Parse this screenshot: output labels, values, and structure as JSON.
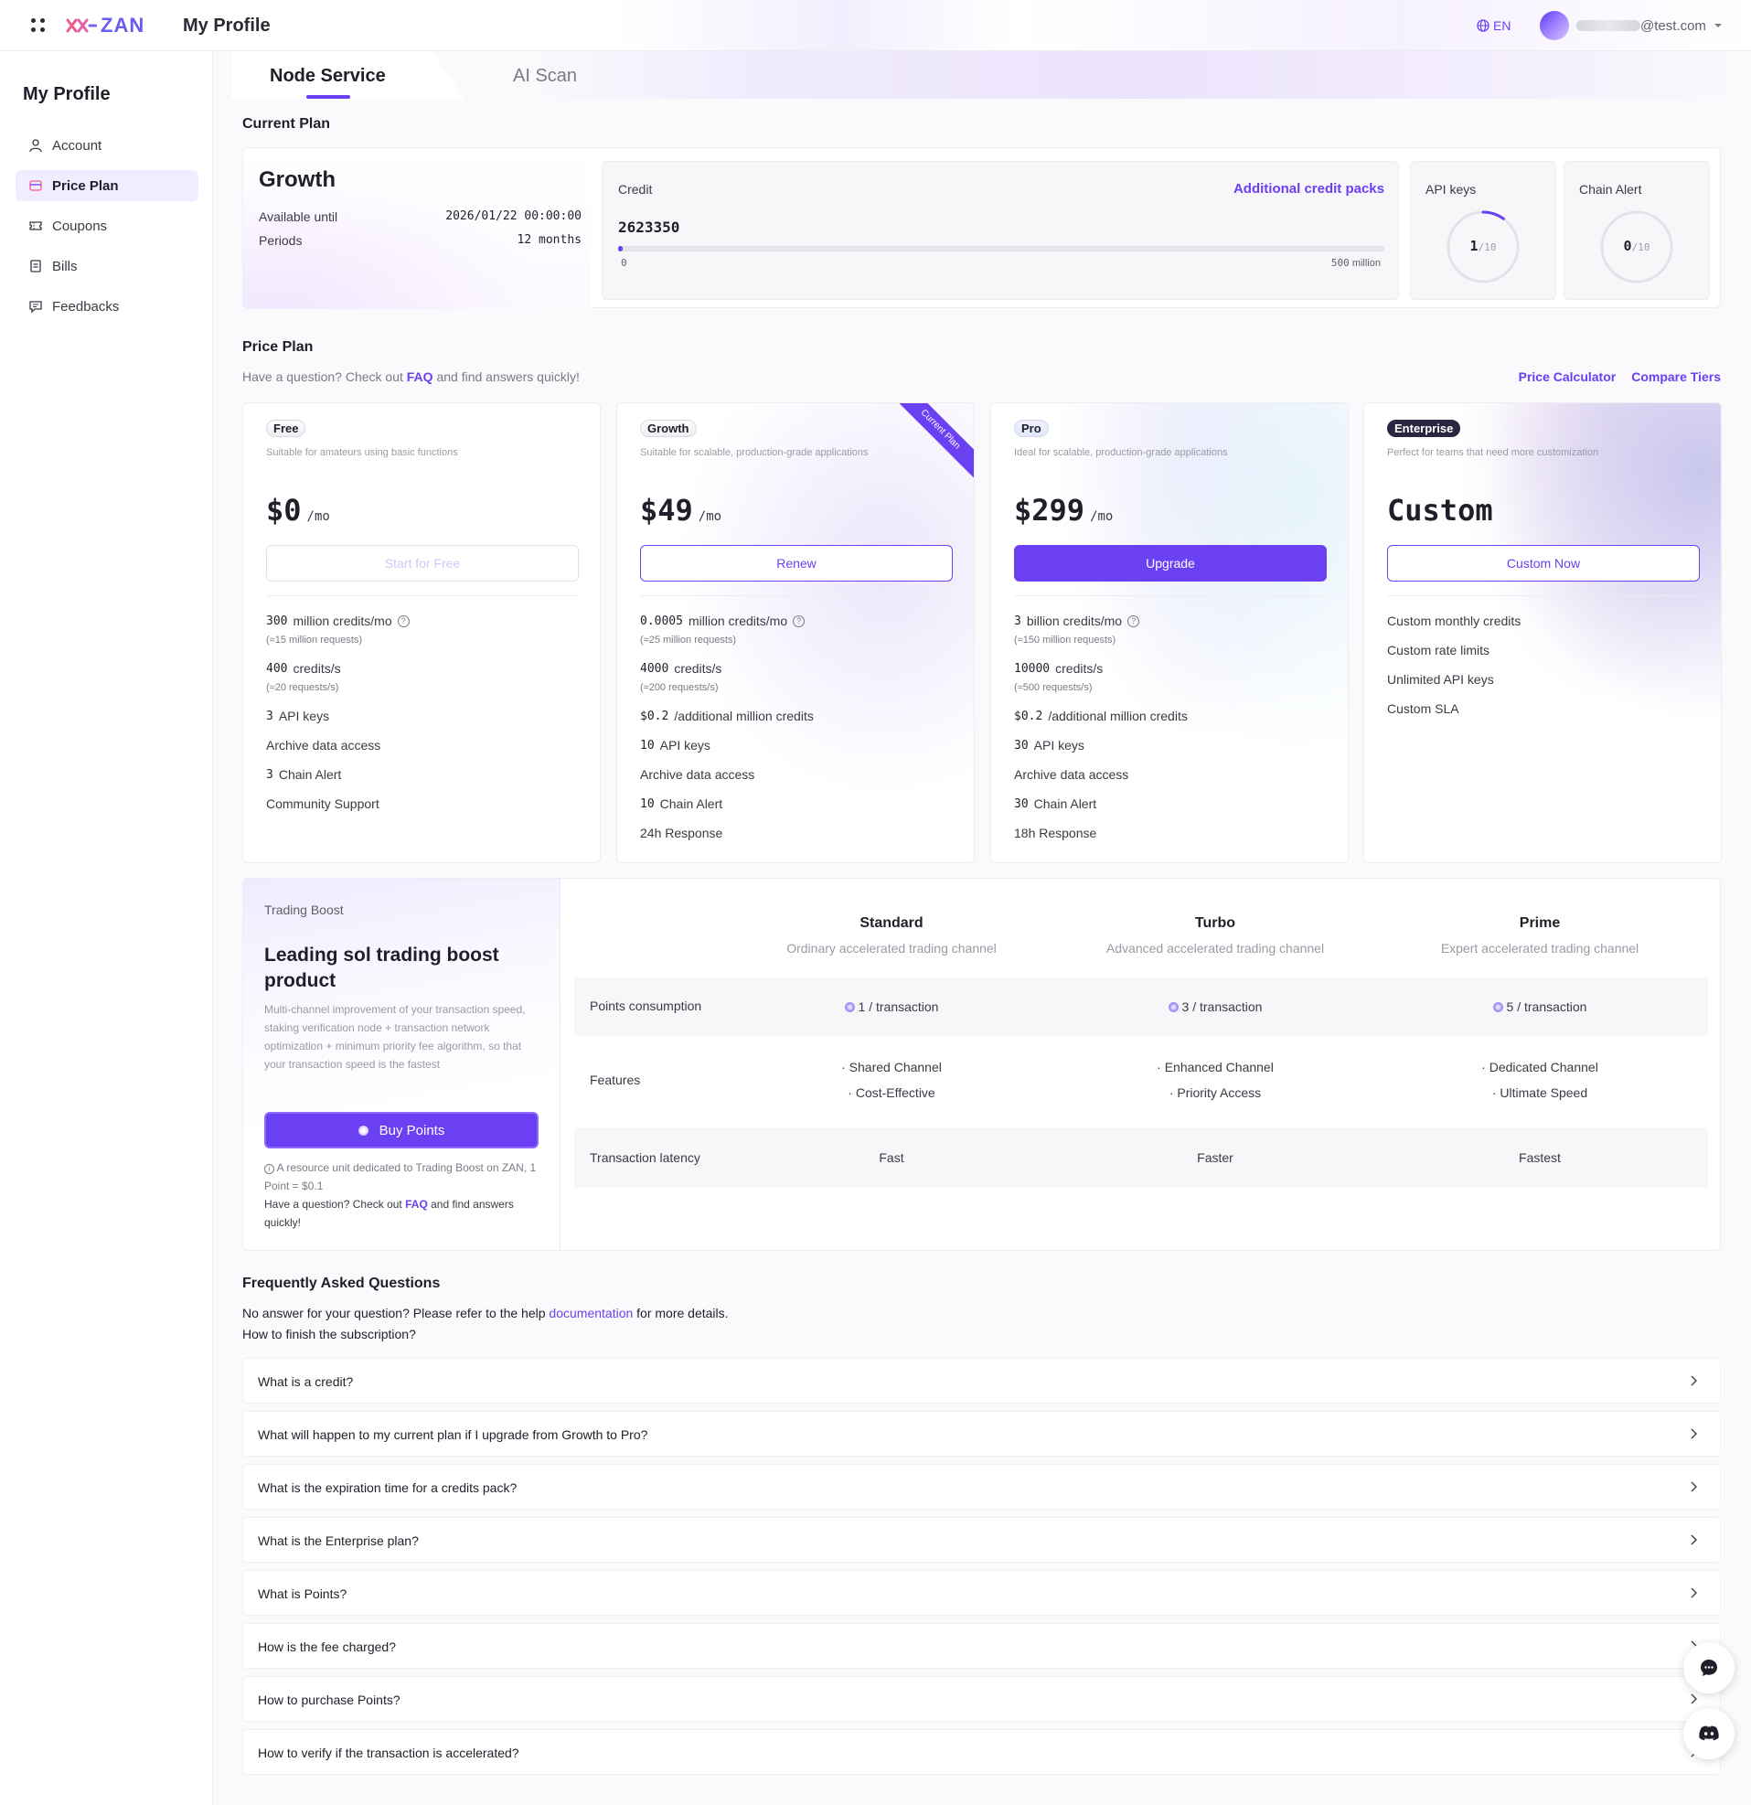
{
  "header": {
    "logo_text": "ZAN",
    "app_title": "My Profile",
    "lang": "EN",
    "user_email_suffix": "@test.com"
  },
  "sidebar": {
    "title": "My Profile",
    "items": [
      {
        "label": "Account",
        "icon": "user-icon",
        "active": false
      },
      {
        "label": "Price Plan",
        "icon": "price-plan-icon",
        "active": true
      },
      {
        "label": "Coupons",
        "icon": "ticket-icon",
        "active": false
      },
      {
        "label": "Bills",
        "icon": "document-icon",
        "active": false
      },
      {
        "label": "Feedbacks",
        "icon": "message-icon",
        "active": false
      }
    ]
  },
  "tabs": [
    {
      "label": "Node Service",
      "active": true
    },
    {
      "label": "AI Scan",
      "active": false
    }
  ],
  "current_plan": {
    "section_title": "Current Plan",
    "name": "Growth",
    "available_label": "Available until",
    "available_value": "2026/01/22 00:00:00",
    "periods_label": "Periods",
    "periods_value": "12 months",
    "credit_label": "Credit",
    "credit_link": "Additional credit packs",
    "credit_value": "2623350",
    "credit_min": "0",
    "credit_max": "500",
    "credit_max_unit": "million",
    "credit_progress_pct": 0.52,
    "api_keys_label": "API keys",
    "api_keys_used": "1",
    "api_keys_total": "/10",
    "api_keys_fraction": 0.1,
    "chain_alert_label": "Chain Alert",
    "chain_alert_used": "0",
    "chain_alert_total": "/10",
    "chain_alert_fraction": 0.0
  },
  "price_plan": {
    "section_title": "Price Plan",
    "sub_pre": "Have a question? Check out ",
    "sub_link": "FAQ",
    "sub_post": " and find answers quickly!",
    "link_calculator": "Price Calculator",
    "link_compare": "Compare Tiers",
    "ribbon": "Current Plan",
    "tiers": [
      {
        "badge": "Free",
        "desc": "Suitable for amateurs using basic functions",
        "price": "$0",
        "unit": "/mo",
        "button": "Start for Free",
        "f1_num": "300",
        "f1_txt": "million credits/mo",
        "f1_sub": "(≈15 million requests)",
        "f2_num": "400",
        "f2_txt": "credits/s",
        "f2_sub": "(≈20 requests/s)",
        "f3_num": "3",
        "f3_txt": "API keys",
        "f4_txt": "Archive data access",
        "f5_num": "3",
        "f5_txt": "Chain Alert",
        "f6_txt": "Community Support"
      },
      {
        "badge": "Growth",
        "desc": "Suitable for scalable, production-grade applications",
        "price": "$49",
        "unit": "/mo",
        "button": "Renew",
        "f1_num": "0.0005",
        "f1_txt": "million credits/mo",
        "f1_sub": "(≈25 million requests)",
        "f2_num": "4000",
        "f2_txt": "credits/s",
        "f2_sub": "(≈200 requests/s)",
        "f3_num": "$0.2",
        "f3_txt": "/additional million credits",
        "f4_num": "10",
        "f4_txt": "API keys",
        "f5_txt": "Archive data access",
        "f6_num": "10",
        "f6_txt": "Chain Alert",
        "f7_txt": "24h Response"
      },
      {
        "badge": "Pro",
        "desc": "Ideal for scalable, production-grade applications",
        "price": "$299",
        "unit": "/mo",
        "button": "Upgrade",
        "f1_num": "3",
        "f1_txt": "billion credits/mo",
        "f1_sub": "(≈150 million requests)",
        "f2_num": "10000",
        "f2_txt": "credits/s",
        "f2_sub": "(≈500 requests/s)",
        "f3_num": "$0.2",
        "f3_txt": "/additional million credits",
        "f4_num": "30",
        "f4_txt": "API keys",
        "f5_txt": "Archive data access",
        "f6_num": "30",
        "f6_txt": "Chain Alert",
        "f7_txt": "18h Response"
      },
      {
        "badge": "Enterprise",
        "desc": "Perfect for teams that need more customization",
        "price": "Custom",
        "button": "Custom Now",
        "f1_txt": "Custom monthly credits",
        "f2_txt": "Custom rate limits",
        "f3_txt": "Unlimited API keys",
        "f4_txt": "Custom SLA"
      }
    ]
  },
  "trading_boost": {
    "kicker": "Trading Boost",
    "title": "Leading sol trading boost product",
    "desc": "Multi-channel improvement of your transaction speed, staking verification node + transaction network optimization + minimum priority fee algorithm, so that your transaction speed is the fastest",
    "button": "Buy Points",
    "note": "A resource unit dedicated to Trading Boost on ZAN, 1 Point = $0.1",
    "note2_pre": "Have a question? Check out ",
    "note2_link": "FAQ",
    "note2_post": " and find answers quickly!",
    "columns": [
      {
        "name": "Standard",
        "desc": "Ordinary accelerated trading channel",
        "points": "1 / transaction",
        "feat1": "· Shared Channel",
        "feat2": "· Cost-Effective",
        "latency": "Fast"
      },
      {
        "name": "Turbo",
        "desc": "Advanced accelerated trading channel",
        "points": "3 / transaction",
        "feat1": "· Enhanced Channel",
        "feat2": "· Priority Access",
        "latency": "Faster"
      },
      {
        "name": "Prime",
        "desc": "Expert accelerated trading channel",
        "points": "5 / transaction",
        "feat1": "· Dedicated Channel",
        "feat2": "· Ultimate Speed",
        "latency": "Fastest"
      }
    ],
    "row_points": "Points consumption",
    "row_features": "Features",
    "row_latency": "Transaction latency"
  },
  "faq": {
    "title": "Frequently Asked Questions",
    "sub_pre": "No answer for your question? Please refer to the help ",
    "sub_link": "documentation",
    "sub_post": " for more details.",
    "sub2": "How to finish the subscription?",
    "items": [
      "What is a credit?",
      "What will happen to my current plan if I upgrade from Growth to Pro?",
      "What is the expiration time for a credits pack?",
      "What is the Enterprise plan?",
      "What is Points?",
      "How is the fee charged?",
      "How to purchase Points?",
      "How to verify if the transaction is accelerated?"
    ]
  }
}
